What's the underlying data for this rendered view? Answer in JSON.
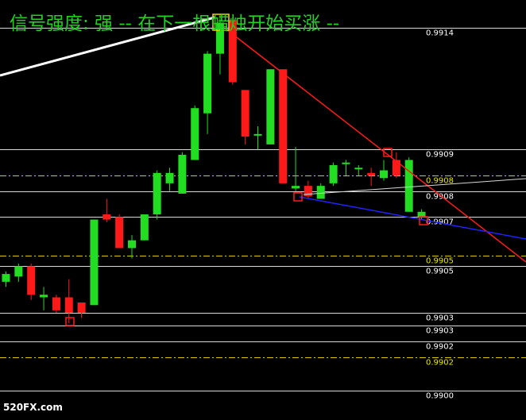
{
  "title": "信号强度: 强  -- 在下一根蜡烛开始买涨 --",
  "watermark": "520FX.com",
  "colors": {
    "background": "#000000",
    "bull": "#22dd22",
    "bear": "#ff1a1a",
    "title": "#22d022",
    "price_label": "#ffffff",
    "level_label": "#e6e600",
    "white_line": "#ffffff",
    "red_line": "#ff1a1a",
    "blue_line": "#2222ff",
    "yellow_dash": "#e6e600"
  },
  "chart_data": {
    "type": "candlestick",
    "ylim": [
      0.98995,
      0.99152
    ],
    "price_labels": [
      {
        "text": "0.9914",
        "value": 0.9914,
        "color": "white"
      },
      {
        "text": "0.9909",
        "value": 0.99093,
        "color": "white"
      },
      {
        "text": "0.9908",
        "value": 0.99083,
        "color": "yellow"
      },
      {
        "text": "0.9908",
        "value": 0.99077,
        "color": "white"
      },
      {
        "text": "0.9907",
        "value": 0.99067,
        "color": "white"
      },
      {
        "text": "0.9905",
        "value": 0.99052,
        "color": "yellow"
      },
      {
        "text": "0.9905",
        "value": 0.99048,
        "color": "white"
      },
      {
        "text": "0.9903",
        "value": 0.9903,
        "color": "white"
      },
      {
        "text": "0.9903",
        "value": 0.99025,
        "color": "white"
      },
      {
        "text": "0.9902",
        "value": 0.99019,
        "color": "white"
      },
      {
        "text": "0.9902",
        "value": 0.99013,
        "color": "yellow"
      },
      {
        "text": "0.9900",
        "value": 0.99,
        "color": "white"
      }
    ],
    "candles": [
      {
        "o": 0.99042,
        "h": 0.99046,
        "l": 0.9904,
        "c": 0.99045
      },
      {
        "o": 0.99044,
        "h": 0.99049,
        "l": 0.99042,
        "c": 0.99048
      },
      {
        "o": 0.99048,
        "h": 0.99049,
        "l": 0.99035,
        "c": 0.99037
      },
      {
        "o": 0.99036,
        "h": 0.9904,
        "l": 0.99031,
        "c": 0.99037
      },
      {
        "o": 0.99036,
        "h": 0.99037,
        "l": 0.9903,
        "c": 0.99031
      },
      {
        "o": 0.99036,
        "h": 0.99043,
        "l": 0.99026,
        "c": 0.9903
      },
      {
        "o": 0.99034,
        "h": 0.99034,
        "l": 0.99028,
        "c": 0.9903
      },
      {
        "o": 0.99033,
        "h": 0.99066,
        "l": 0.99033,
        "c": 0.99066
      },
      {
        "o": 0.99068,
        "h": 0.99074,
        "l": 0.99065,
        "c": 0.99066
      },
      {
        "o": 0.99067,
        "h": 0.99068,
        "l": 0.99055,
        "c": 0.99055
      },
      {
        "o": 0.99055,
        "h": 0.9906,
        "l": 0.99051,
        "c": 0.99058
      },
      {
        "o": 0.99058,
        "h": 0.99068,
        "l": 0.99058,
        "c": 0.99068
      },
      {
        "o": 0.99068,
        "h": 0.99085,
        "l": 0.99066,
        "c": 0.99084
      },
      {
        "o": 0.9908,
        "h": 0.99086,
        "l": 0.99077,
        "c": 0.99084
      },
      {
        "o": 0.99076,
        "h": 0.99092,
        "l": 0.99076,
        "c": 0.99091
      },
      {
        "o": 0.99089,
        "h": 0.9911,
        "l": 0.99089,
        "c": 0.99109
      },
      {
        "o": 0.99107,
        "h": 0.99131,
        "l": 0.99099,
        "c": 0.9913
      },
      {
        "o": 0.9913,
        "h": 0.99145,
        "l": 0.99122,
        "c": 0.99142
      },
      {
        "o": 0.99143,
        "h": 0.99144,
        "l": 0.99118,
        "c": 0.99119
      },
      {
        "o": 0.99116,
        "h": 0.99116,
        "l": 0.99095,
        "c": 0.99098
      },
      {
        "o": 0.99099,
        "h": 0.99102,
        "l": 0.99093,
        "c": 0.99099
      },
      {
        "o": 0.99095,
        "h": 0.99124,
        "l": 0.99095,
        "c": 0.99124
      },
      {
        "o": 0.99124,
        "h": 0.99124,
        "l": 0.9908,
        "c": 0.9908
      },
      {
        "o": 0.99078,
        "h": 0.99094,
        "l": 0.99077,
        "c": 0.99079
      },
      {
        "o": 0.99079,
        "h": 0.99081,
        "l": 0.99074,
        "c": 0.99075
      },
      {
        "o": 0.99074,
        "h": 0.9908,
        "l": 0.99074,
        "c": 0.99079
      },
      {
        "o": 0.9908,
        "h": 0.99088,
        "l": 0.99079,
        "c": 0.99087
      },
      {
        "o": 0.99088,
        "h": 0.99089,
        "l": 0.99083,
        "c": 0.99088
      },
      {
        "o": 0.99086,
        "h": 0.99087,
        "l": 0.99083,
        "c": 0.99086
      },
      {
        "o": 0.99084,
        "h": 0.99086,
        "l": 0.99079,
        "c": 0.99083
      },
      {
        "o": 0.99082,
        "h": 0.99089,
        "l": 0.99081,
        "c": 0.99085
      },
      {
        "o": 0.99089,
        "h": 0.99092,
        "l": 0.99082,
        "c": 0.99083
      },
      {
        "o": 0.99069,
        "h": 0.9909,
        "l": 0.99069,
        "c": 0.99089
      },
      {
        "o": 0.99067,
        "h": 0.9907,
        "l": 0.99066,
        "c": 0.99069
      }
    ]
  }
}
